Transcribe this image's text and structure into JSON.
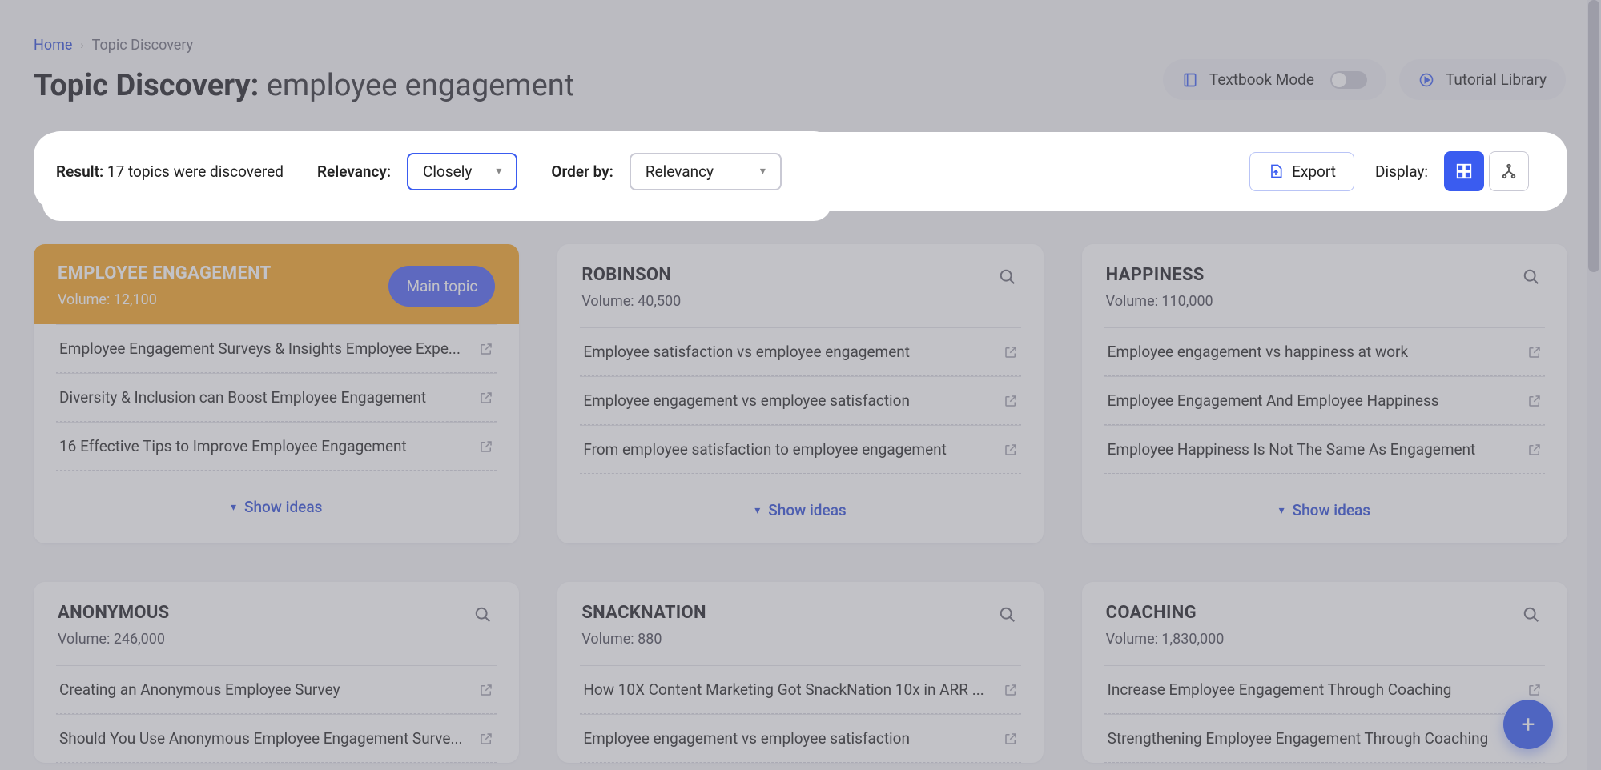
{
  "breadcrumb": {
    "home": "Home",
    "current": "Topic Discovery"
  },
  "title_prefix": "Topic Discovery:",
  "title_query": "employee engagement",
  "top_actions": {
    "textbook_mode": "Textbook Mode",
    "tutorial_library": "Tutorial Library"
  },
  "filters": {
    "result_label": "Result:",
    "result_text": "17 topics were discovered",
    "relevancy_label": "Relevancy:",
    "relevancy_value": "Closely",
    "orderby_label": "Order by:",
    "orderby_value": "Relevancy",
    "export_label": "Export",
    "display_label": "Display:"
  },
  "strings": {
    "show_ideas": "Show ideas",
    "volume_prefix": "Volume:"
  },
  "cards": [
    {
      "title": "EMPLOYEE ENGAGEMENT",
      "volume": "12,100",
      "main": true,
      "main_badge": "Main topic",
      "items": [
        "Employee Engagement Surveys & Insights Employee Expe...",
        "Diversity & Inclusion can Boost Employee Engagement",
        "16 Effective Tips to Improve Employee Engagement"
      ]
    },
    {
      "title": "ROBINSON",
      "volume": "40,500",
      "items": [
        "Employee satisfaction vs employee engagement",
        "Employee engagement vs employee satisfaction",
        "From employee satisfaction to employee engagement"
      ]
    },
    {
      "title": "HAPPINESS",
      "volume": "110,000",
      "items": [
        "Employee engagement vs happiness at work",
        "Employee Engagement And Employee Happiness",
        "Employee Happiness Is Not The Same As Engagement"
      ]
    },
    {
      "title": "ANONYMOUS",
      "volume": "246,000",
      "items": [
        "Creating an Anonymous Employee Survey",
        "Should You Use Anonymous Employee Engagement Surve..."
      ]
    },
    {
      "title": "SNACKNATION",
      "volume": "880",
      "items": [
        "How 10X Content Marketing Got SnackNation 10x in ARR ...",
        "Employee engagement vs employee satisfaction"
      ]
    },
    {
      "title": "COACHING",
      "volume": "1,830,000",
      "items": [
        "Increase Employee Engagement Through Coaching",
        "Strengthening Employee Engagement Through Coaching"
      ]
    }
  ]
}
